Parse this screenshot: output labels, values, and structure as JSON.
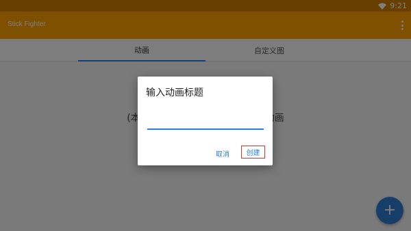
{
  "status_bar": {
    "time": "9:21"
  },
  "app_bar": {
    "title": "Stick Fighter"
  },
  "tabs": [
    {
      "label": "动画",
      "selected": true
    },
    {
      "label": "自定义图",
      "selected": false
    }
  ],
  "content": {
    "empty_text": "(本地暂无动画，点击右下角创建动画"
  },
  "fab": {
    "label": "+"
  },
  "dialog": {
    "title": "输入动画标题",
    "input_value": "",
    "cancel_label": "取消",
    "create_label": "创建"
  },
  "colors": {
    "accent": "#2e7dd2",
    "app_bar": "#ffa000",
    "status_bar": "#d27f00",
    "highlight": "#e03030"
  }
}
